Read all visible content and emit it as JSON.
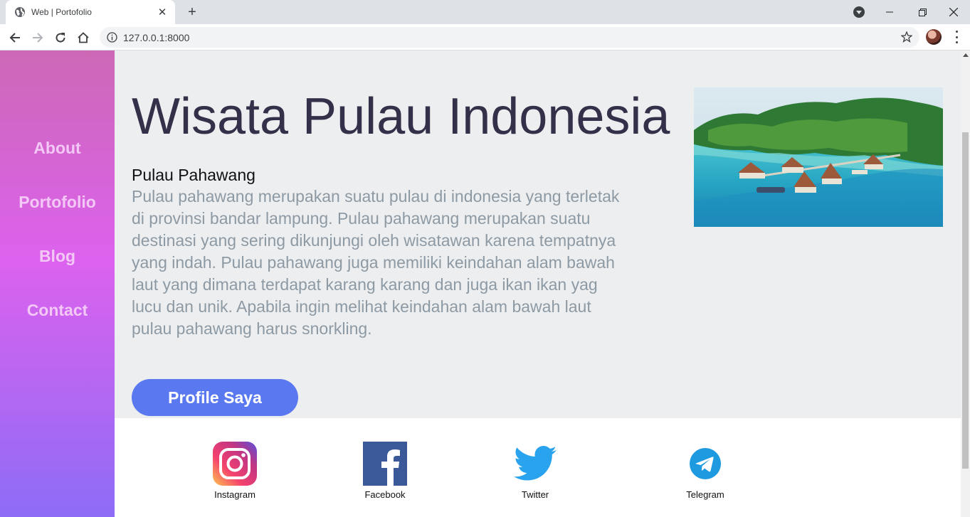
{
  "browser": {
    "tab_title": "Web | Portofolio",
    "url": "127.0.0.1:8000"
  },
  "sidebar": {
    "items": [
      {
        "label": "About"
      },
      {
        "label": "Portofolio"
      },
      {
        "label": "Blog"
      },
      {
        "label": "Contact"
      }
    ]
  },
  "main": {
    "title": "Wisata Pulau Indonesia",
    "subtitle": "Pulau Pahawang",
    "description": "Pulau pahawang merupakan suatu pulau di indonesia yang terletak di provinsi bandar lampung. Pulau pahawang merupakan suatu destinasi yang sering dikunjungi oleh wisatawan karena tempatnya yang indah. Pulau pahawang juga memiliki keindahan alam bawah laut yang dimana terdapat karang karang dan juga ikan ikan yag lucu dan unik. Apabila ingin melihat keindahan alam bawah laut pulau pahawang harus snorkling.",
    "button_label": "Profile Saya"
  },
  "footer": {
    "social": [
      {
        "label": "Instagram",
        "icon": "instagram-icon"
      },
      {
        "label": "Facebook",
        "icon": "facebook-icon"
      },
      {
        "label": "Twitter",
        "icon": "twitter-icon"
      },
      {
        "label": "Telegram",
        "icon": "telegram-icon"
      }
    ]
  },
  "colors": {
    "sidebar_gradient": [
      "#cd68b5",
      "#dc62ee",
      "#8d6cf6"
    ],
    "button": "#5a78f0",
    "title": "#35304a",
    "description": "#8d9aa4"
  }
}
